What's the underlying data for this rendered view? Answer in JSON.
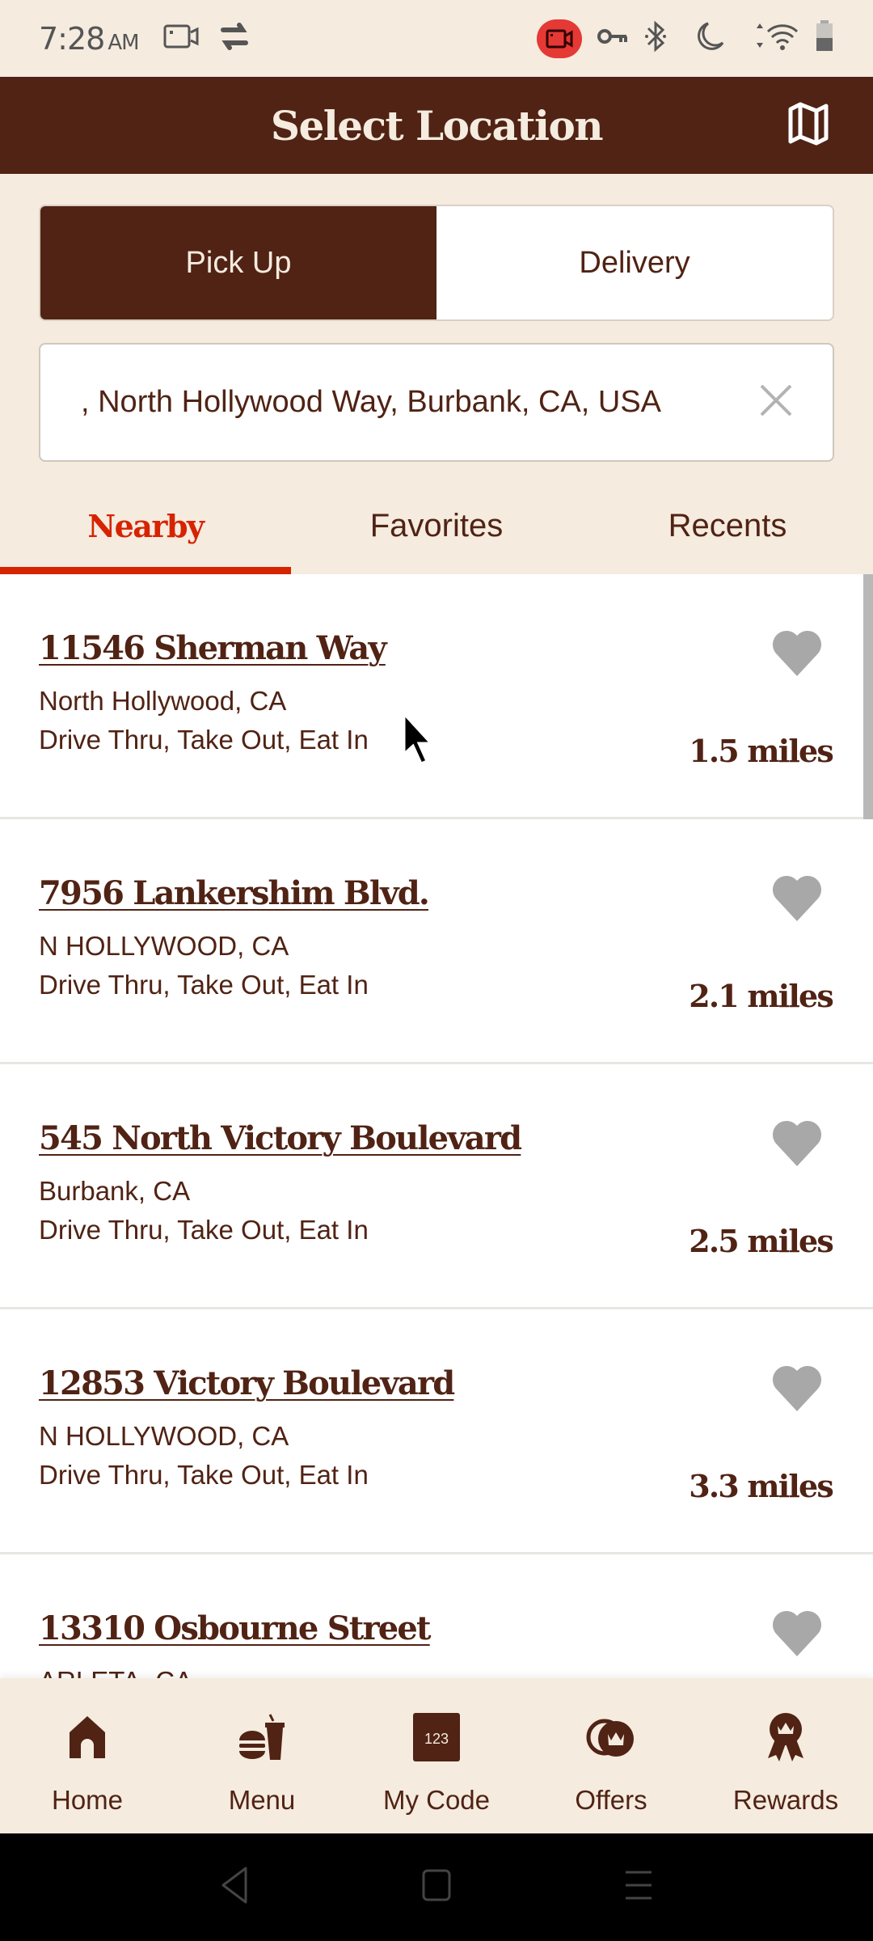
{
  "status_bar": {
    "time": "7:28",
    "ampm": "AM",
    "left_icons": [
      "screen-record-icon",
      "sync-icon"
    ],
    "right_icons": [
      "recording-indicator-icon",
      "vpn-key-icon",
      "bluetooth-icon",
      "do-not-disturb-icon",
      "wifi-icon",
      "battery-icon"
    ]
  },
  "header": {
    "title": "Select Location",
    "map_icon": "map-icon"
  },
  "order_type": {
    "options": [
      {
        "label": "Pick Up",
        "selected": true
      },
      {
        "label": "Delivery",
        "selected": false
      }
    ]
  },
  "search": {
    "value": ", North Hollywood Way, Burbank, CA, USA",
    "clear_icon": "close-icon"
  },
  "tabs": [
    {
      "label": "Nearby",
      "active": true
    },
    {
      "label": "Favorites",
      "active": false
    },
    {
      "label": "Recents",
      "active": false
    }
  ],
  "locations": [
    {
      "name": "11546 Sherman Way",
      "city": "North Hollywood, CA",
      "services": "Drive Thru, Take Out, Eat In",
      "distance": "1.5 miles",
      "favorite": false
    },
    {
      "name": "7956 Lankershim Blvd.",
      "city": "N HOLLYWOOD, CA",
      "services": "Drive Thru, Take Out, Eat In",
      "distance": "2.1 miles",
      "favorite": false
    },
    {
      "name": "545 North Victory Boulevard",
      "city": "Burbank, CA",
      "services": "Drive Thru, Take Out, Eat In",
      "distance": "2.5 miles",
      "favorite": false
    },
    {
      "name": "12853 Victory Boulevard",
      "city": "N HOLLYWOOD, CA",
      "services": "Drive Thru, Take Out, Eat In",
      "distance": "3.3 miles",
      "favorite": false
    },
    {
      "name": "13310 Osbourne Street",
      "city": "ARLETA, CA",
      "services": "",
      "distance": "",
      "favorite": false
    }
  ],
  "bottom_nav": [
    {
      "label": "Home",
      "icon": "home-icon"
    },
    {
      "label": "Menu",
      "icon": "burger-drink-icon"
    },
    {
      "label": "My Code",
      "icon": "code-123-icon",
      "icon_text": "123"
    },
    {
      "label": "Offers",
      "icon": "offers-crown-icon"
    },
    {
      "label": "Rewards",
      "icon": "rewards-ribbon-icon"
    }
  ],
  "colors": {
    "brand_brown": "#502314",
    "cream": "#f5ebdf",
    "accent_red": "#d62300",
    "heart_gray": "#a8a8a8"
  }
}
